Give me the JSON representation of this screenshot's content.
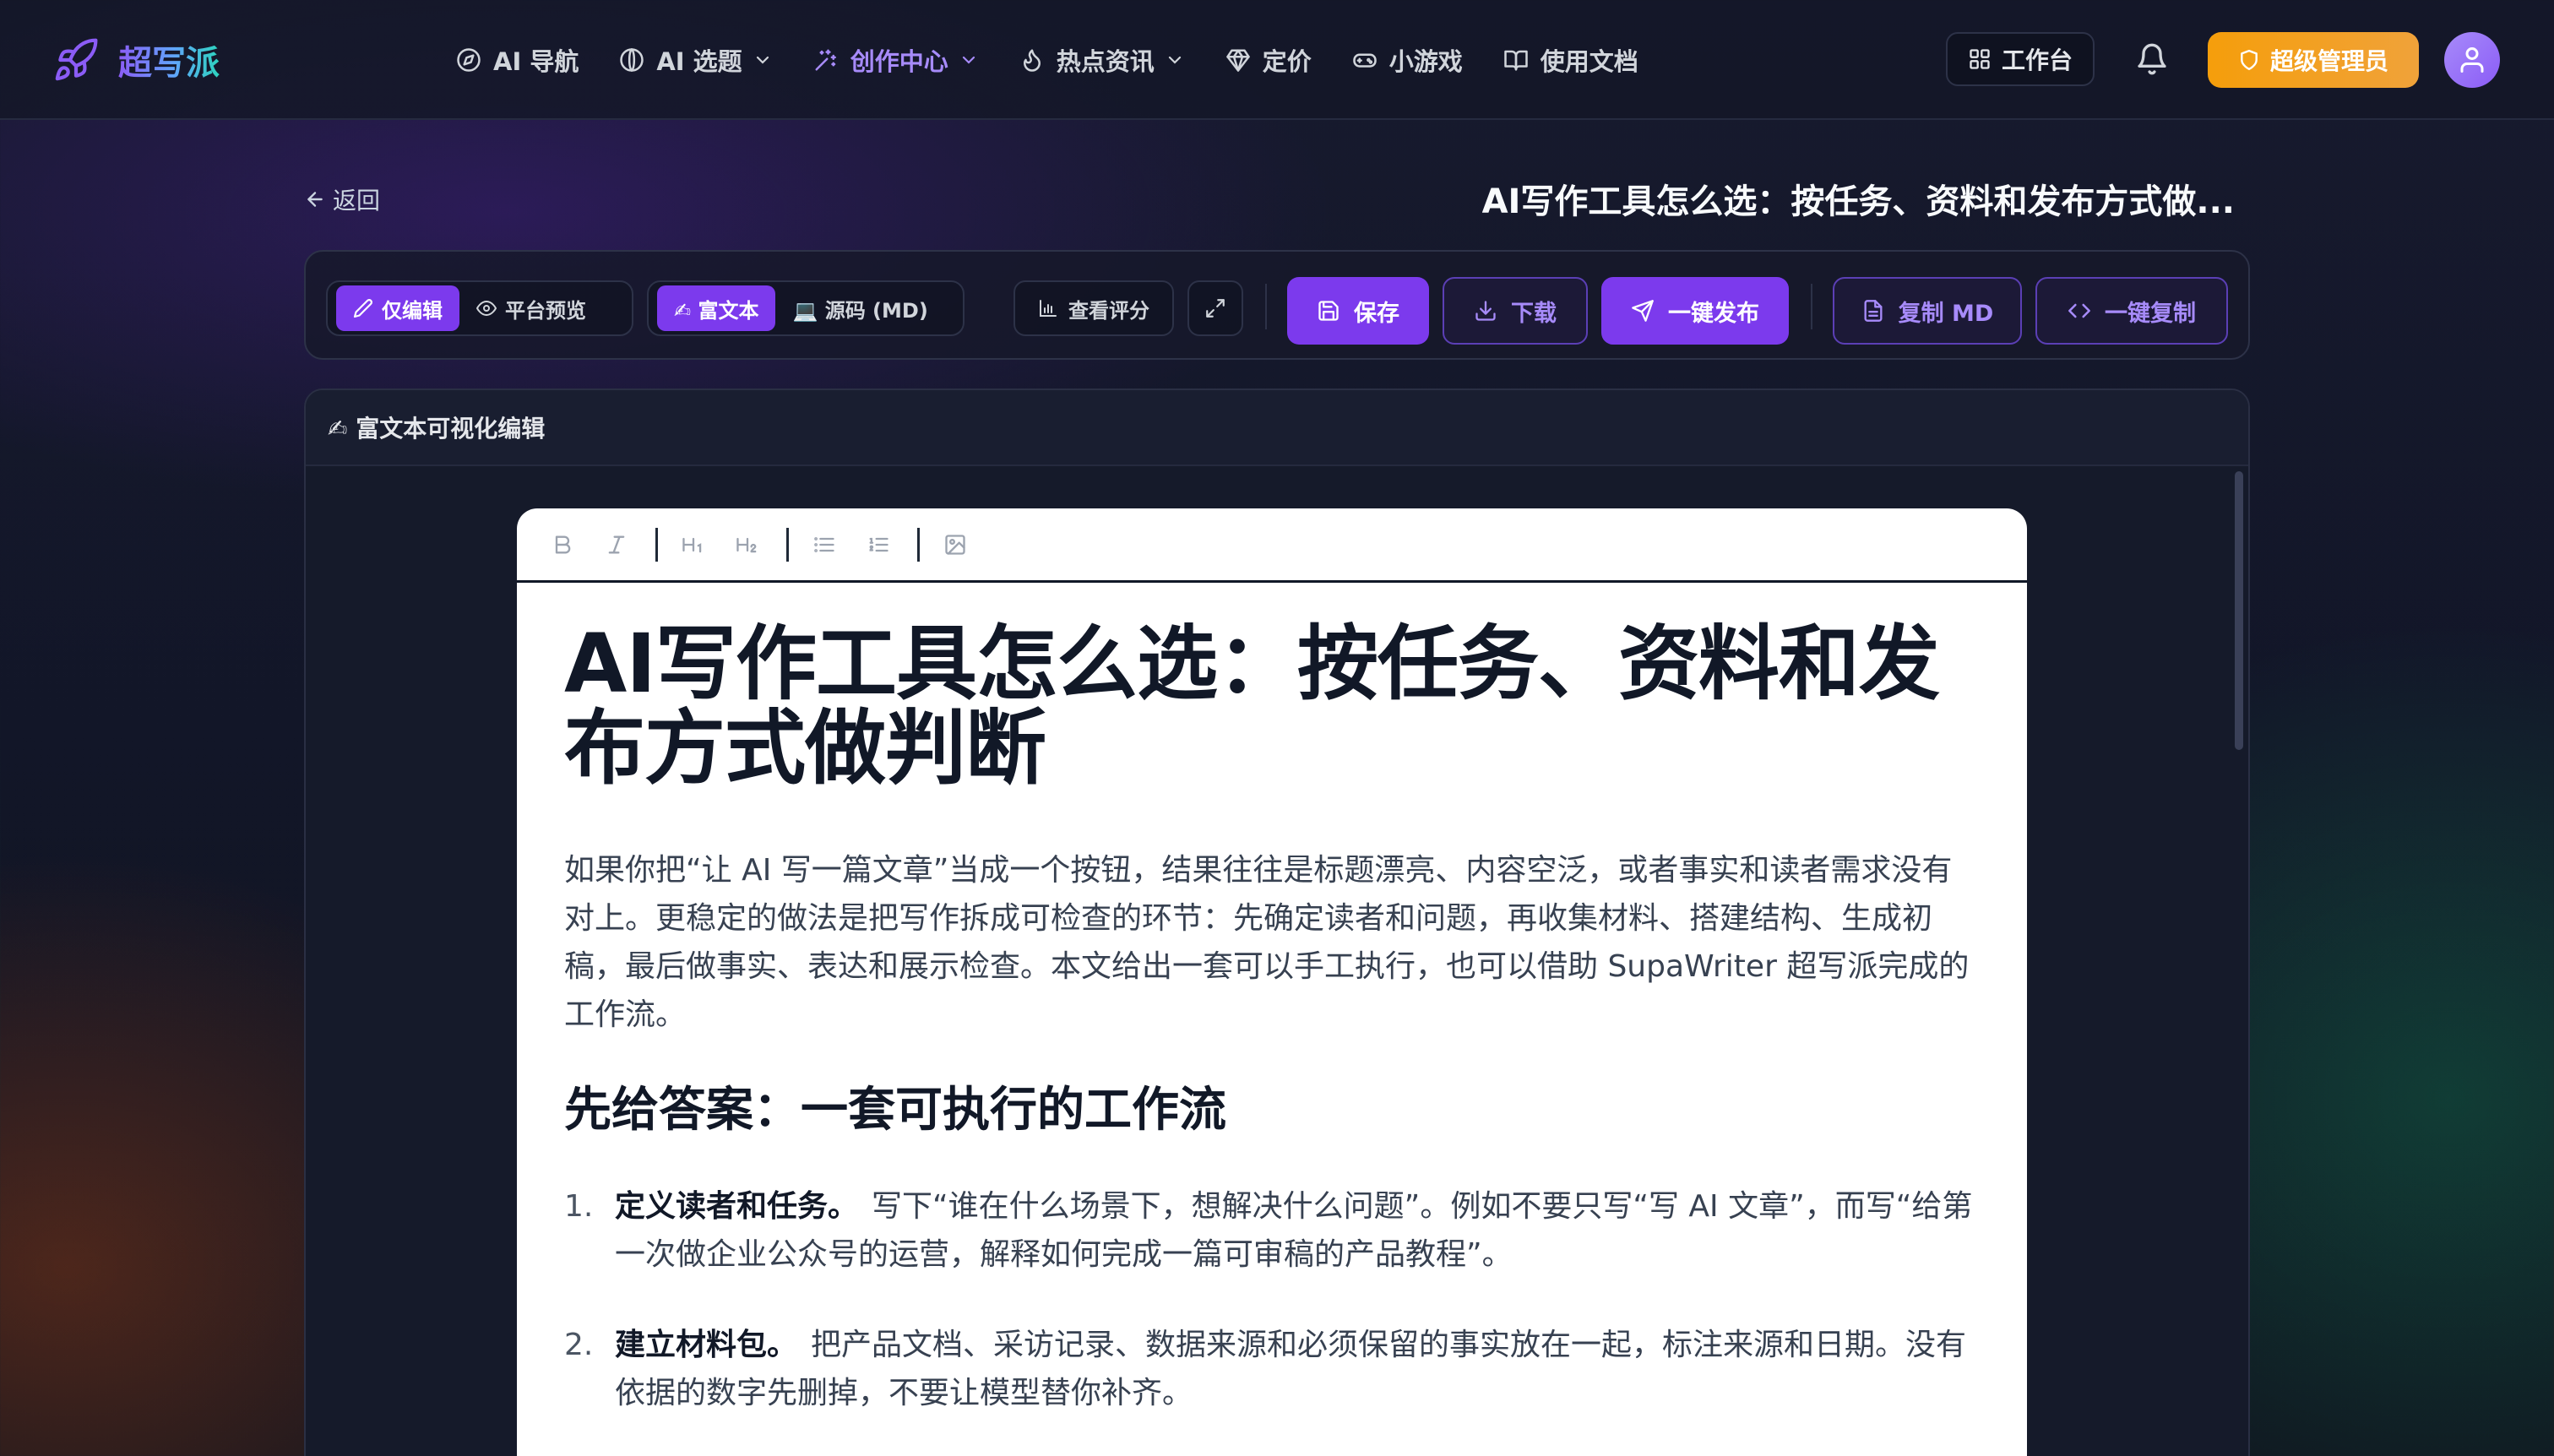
{
  "brand": {
    "name": "超写派"
  },
  "nav": {
    "items": [
      {
        "label": "AI 导航",
        "icon": "compass-icon"
      },
      {
        "label": "AI 选题",
        "icon": "lightbulb-icon"
      },
      {
        "label": "创作中心",
        "icon": "sparkles-icon"
      },
      {
        "label": "热点资讯",
        "icon": "flame-icon"
      },
      {
        "label": "定价",
        "icon": "gem-icon"
      },
      {
        "label": "小游戏",
        "icon": "gamepad-icon"
      },
      {
        "label": "使用文档",
        "icon": "book-icon"
      }
    ],
    "active": "创作中心"
  },
  "header_right": {
    "workbench": "工作台",
    "admin": "超级管理员"
  },
  "page": {
    "back": "返回",
    "title": "AI写作工具怎么选：按任务、资料和发布方式做..."
  },
  "toolbar": {
    "mode_edit": "仅编辑",
    "mode_preview": "平台预览",
    "format_rich": "✍ 富文本",
    "format_source": "💻 源码 (MD)",
    "score": "查看评分",
    "save": "保存",
    "download": "下载",
    "publish": "一键发布",
    "copy_md": "复制 MD",
    "copy_all": "一键复制"
  },
  "panel": {
    "heading": "✍ 富文本可视化编辑"
  },
  "editor_tools": [
    "bold-icon",
    "italic-icon",
    "heading-1-icon",
    "heading-2-icon",
    "bullet-list-icon",
    "ordered-list-icon",
    "image-icon"
  ],
  "document": {
    "h1": "AI写作工具怎么选：按任务、资料和发布方式做判断",
    "intro": "如果你把“让 AI 写一篇文章”当成一个按钮，结果往往是标题漂亮、内容空泛，或者事实和读者需求没有对上。更稳定的做法是把写作拆成可检查的环节：先确定读者和问题，再收集材料、搭建结构、生成初稿，最后做事实、表达和展示检查。本文给出一套可以手工执行，也可以借助 SupaWriter 超写派完成的工作流。",
    "h2": "先给答案：一套可执行的工作流",
    "list": [
      {
        "num": "1.",
        "bold": "定义读者和任务。",
        "text": "写下“谁在什么场景下，想解决什么问题”。例如不要只写“写 AI 文章”，而写“给第一次做企业公众号的运营，解释如何完成一篇可审稿的产品教程”。"
      },
      {
        "num": "2.",
        "bold": "建立材料包。",
        "text": "把产品文档、采访记录、数据来源和必须保留的事实放在一起，标注来源和日期。没有依据的数字先删掉，不要让模型替你补齐。"
      }
    ]
  },
  "colors": {
    "accent": "#7c3aed",
    "accent_light": "#a78bfa",
    "admin": "#f59e0b",
    "bg": "#141828"
  }
}
